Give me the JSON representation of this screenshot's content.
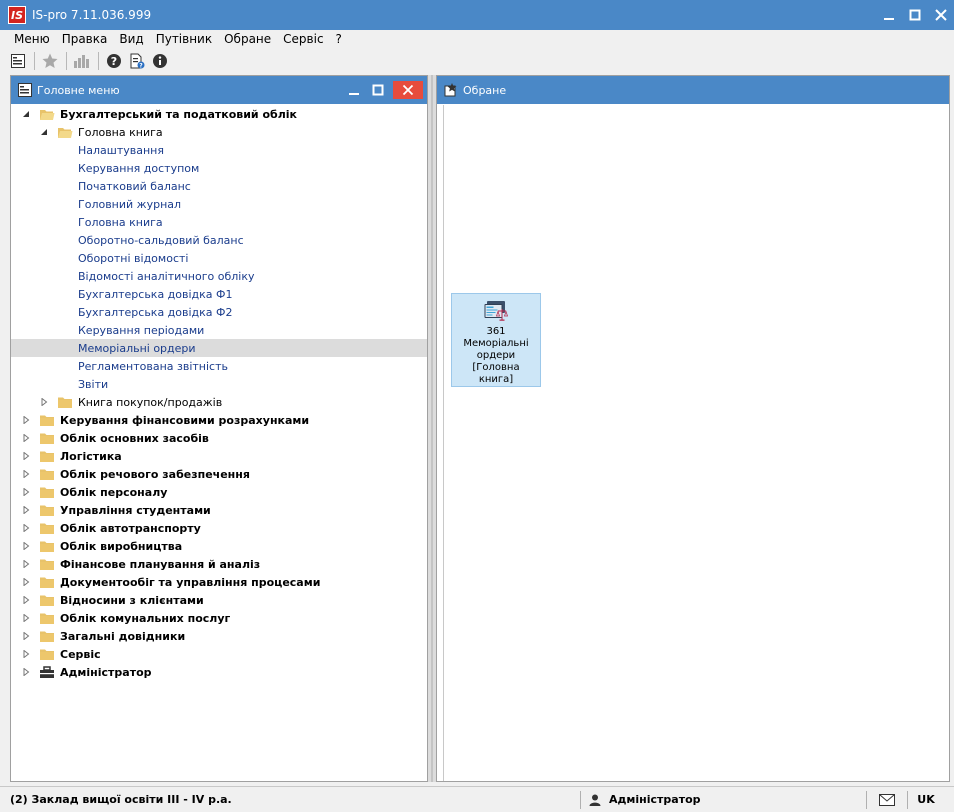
{
  "app": {
    "logo_text": "IS",
    "title": "IS-pro 7.11.036.999"
  },
  "menubar": {
    "items": [
      "Меню",
      "Правка",
      "Вид",
      "Путівник",
      "Обране",
      "Сервіс",
      "?"
    ]
  },
  "toolbar": {
    "icons": [
      "tree-view-icon",
      "favorite-star-icon",
      "chart-icon",
      "help-icon",
      "document-help-icon",
      "info-icon"
    ]
  },
  "left_panel": {
    "title": "Головне меню",
    "tree": [
      {
        "label": "Бухгалтерський та податковий облік",
        "level": 0,
        "expanded": true,
        "kind": "folder-open"
      },
      {
        "label": "Головна книга",
        "level": 1,
        "expanded": true,
        "kind": "folder-open"
      },
      {
        "label": "Налаштування",
        "level": 2,
        "kind": "leaf"
      },
      {
        "label": "Керування доступом",
        "level": 2,
        "kind": "leaf"
      },
      {
        "label": "Початковий баланс",
        "level": 2,
        "kind": "leaf"
      },
      {
        "label": "Головний журнал",
        "level": 2,
        "kind": "leaf"
      },
      {
        "label": "Головна книга",
        "level": 2,
        "kind": "leaf"
      },
      {
        "label": "Оборотно-сальдовий баланс",
        "level": 2,
        "kind": "leaf"
      },
      {
        "label": "Оборотні відомості",
        "level": 2,
        "kind": "leaf"
      },
      {
        "label": "Відомості аналітичного обліку",
        "level": 2,
        "kind": "leaf"
      },
      {
        "label": "Бухгалтерська довідка Ф1",
        "level": 2,
        "kind": "leaf"
      },
      {
        "label": "Бухгалтерська довідка Ф2",
        "level": 2,
        "kind": "leaf"
      },
      {
        "label": "Керування періодами",
        "level": 2,
        "kind": "leaf"
      },
      {
        "label": "Меморіальні ордери",
        "level": 2,
        "kind": "leaf",
        "selected": true
      },
      {
        "label": "Регламентована звітність",
        "level": 2,
        "kind": "leaf"
      },
      {
        "label": "Звіти",
        "level": 2,
        "kind": "leaf"
      },
      {
        "label": "Книга покупок/продажів",
        "level": 1,
        "expanded": false,
        "kind": "folder"
      },
      {
        "label": "Керування фінансовими розрахунками",
        "level": 0,
        "expanded": false,
        "kind": "folder"
      },
      {
        "label": "Облік основних засобів",
        "level": 0,
        "expanded": false,
        "kind": "folder"
      },
      {
        "label": "Логістика",
        "level": 0,
        "expanded": false,
        "kind": "folder"
      },
      {
        "label": "Облік речового забезпечення",
        "level": 0,
        "expanded": false,
        "kind": "folder"
      },
      {
        "label": "Облік персоналу",
        "level": 0,
        "expanded": false,
        "kind": "folder"
      },
      {
        "label": "Управління студентами",
        "level": 0,
        "expanded": false,
        "kind": "folder"
      },
      {
        "label": "Облік автотранспорту",
        "level": 0,
        "expanded": false,
        "kind": "folder"
      },
      {
        "label": "Облік виробництва",
        "level": 0,
        "expanded": false,
        "kind": "folder"
      },
      {
        "label": "Фінансове планування й аналіз",
        "level": 0,
        "expanded": false,
        "kind": "folder"
      },
      {
        "label": "Документообіг та управління процесами",
        "level": 0,
        "expanded": false,
        "kind": "folder"
      },
      {
        "label": "Відносини з клієнтами",
        "level": 0,
        "expanded": false,
        "kind": "folder"
      },
      {
        "label": "Облік комунальних послуг",
        "level": 0,
        "expanded": false,
        "kind": "folder"
      },
      {
        "label": "Загальні довідники",
        "level": 0,
        "expanded": false,
        "kind": "folder"
      },
      {
        "label": "Сервіс",
        "level": 0,
        "expanded": false,
        "kind": "folder"
      },
      {
        "label": "Адміністратор",
        "level": 0,
        "expanded": false,
        "kind": "admin"
      }
    ]
  },
  "right_panel": {
    "title": "Обране",
    "favorites": [
      {
        "label": "361 Меморіальні ордери [Головна книга]",
        "icon": "memorial-orders-scales-icon"
      }
    ]
  },
  "statusbar": {
    "org": "(2) Заклад вищої освіти III - IV р.а.",
    "user": "Адміністратор",
    "lang": "UK"
  },
  "colors": {
    "accent": "#4a88c7",
    "close": "#e74c3c",
    "leaf_text": "#1a3c8c",
    "folder": "#e8c36a"
  }
}
